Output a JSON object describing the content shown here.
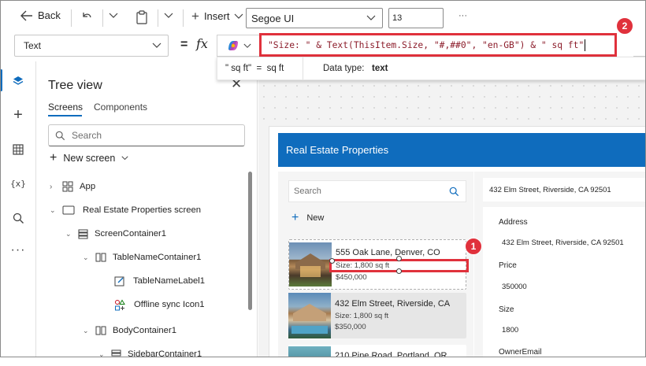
{
  "toolbar": {
    "back_label": "Back",
    "insert_label": "Insert",
    "font_name": "Segoe UI",
    "font_size": "13",
    "more_label": "···"
  },
  "formula_bar": {
    "property": "Text",
    "equals": "=",
    "fx": "fx",
    "formula": "\"Size: \" & Text(ThisItem.Size, \"#,##0\", \"en-GB\") & \" sq ft\"",
    "hint_expression": "\" sq ft\"  =  sq ft",
    "hint_type_label": "Data type:",
    "hint_type_value": "text"
  },
  "callouts": {
    "one": "1",
    "two": "2"
  },
  "tree_view": {
    "title": "Tree view",
    "tabs": [
      "Screens",
      "Components"
    ],
    "search_placeholder": "Search",
    "new_screen_label": "New screen",
    "items": [
      {
        "label": "App"
      },
      {
        "label": "Real Estate Properties screen"
      },
      {
        "label": "ScreenContainer1"
      },
      {
        "label": "TableNameContainer1"
      },
      {
        "label": "TableNameLabel1"
      },
      {
        "label": "Offline sync Icon1"
      },
      {
        "label": "BodyContainer1"
      },
      {
        "label": "SidebarContainer1"
      }
    ]
  },
  "app_preview": {
    "header_title": "Real Estate Properties",
    "search_placeholder": "Search",
    "new_label": "New",
    "gallery": [
      {
        "address": "555 Oak Lane, Denver, CO",
        "size": "Size: 1,800 sq ft",
        "price": "$450,000"
      },
      {
        "address": "432 Elm Street, Riverside, CA",
        "size": "Size: 1,800 sq ft",
        "price": "$350,000"
      },
      {
        "address": "210 Pine Road, Portland, OR",
        "size": "",
        "price": ""
      }
    ],
    "detail_header": "432 Elm Street, Riverside, CA 92501",
    "fields": [
      {
        "label": "Address",
        "value": "432 Elm Street, Riverside, CA 92501"
      },
      {
        "label": "Price",
        "value": "350000"
      },
      {
        "label": "Size",
        "value": "1800"
      },
      {
        "label": "OwnerEmail",
        "value": ""
      }
    ]
  }
}
